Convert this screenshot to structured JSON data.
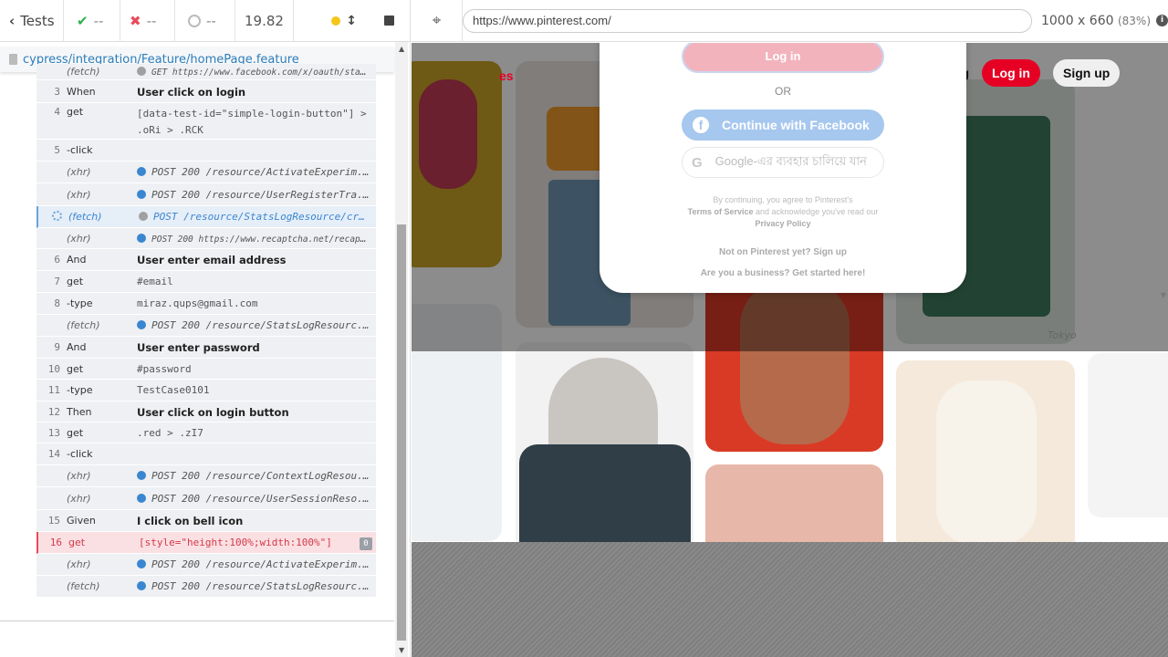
{
  "reporter": {
    "tests_label": "Tests",
    "passed": "--",
    "failed": "--",
    "pending": "--",
    "duration": "19.82",
    "spec_path": "cypress/integration/Feature/homePage.feature"
  },
  "commands": [
    {
      "num": "",
      "name": "(fetch)",
      "msg": "GET https://www.facebook.com/x/oauth/stat...",
      "kind": "evt"
    },
    {
      "num": "3",
      "name": "When",
      "msg": "User click on login",
      "kind": "step"
    },
    {
      "num": "4",
      "name": "get",
      "msg": "[data-test-id=\"simple-login-button\"] > .oRi > .RCK",
      "kind": "cmd"
    },
    {
      "num": "5",
      "name": "-click",
      "msg": "",
      "kind": "cmd"
    },
    {
      "num": "",
      "name": "(xhr)",
      "msg": "POST 200 /resource/ActivateExperim...",
      "kind": "evt"
    },
    {
      "num": "",
      "name": "(xhr)",
      "msg": "POST 200 /resource/UserRegisterTra...",
      "kind": "evt"
    },
    {
      "num": "",
      "name": "(fetch)",
      "msg": "POST /resource/StatsLogResource/cr...",
      "kind": "pending"
    },
    {
      "num": "",
      "name": "(xhr)",
      "msg": "POST 200 https://www.recaptcha.net/recapt...",
      "kind": "evt"
    },
    {
      "num": "6",
      "name": "And",
      "msg": "User enter email address",
      "kind": "step"
    },
    {
      "num": "7",
      "name": "get",
      "msg": "#email",
      "kind": "cmd"
    },
    {
      "num": "8",
      "name": "-type",
      "msg": "miraz.qups@gmail.com",
      "kind": "cmd"
    },
    {
      "num": "",
      "name": "(fetch)",
      "msg": "POST 200 /resource/StatsLogResourc...",
      "kind": "evt"
    },
    {
      "num": "9",
      "name": "And",
      "msg": "User enter password",
      "kind": "step"
    },
    {
      "num": "10",
      "name": "get",
      "msg": "#password",
      "kind": "cmd"
    },
    {
      "num": "11",
      "name": "-type",
      "msg": "TestCase0101",
      "kind": "cmd"
    },
    {
      "num": "12",
      "name": "Then",
      "msg": "User click on login button",
      "kind": "step"
    },
    {
      "num": "13",
      "name": "get",
      "msg": ".red > .zI7",
      "kind": "cmd"
    },
    {
      "num": "14",
      "name": "-click",
      "msg": "",
      "kind": "cmd"
    },
    {
      "num": "",
      "name": "(xhr)",
      "msg": "POST 200 /resource/ContextLogResou...",
      "kind": "evt"
    },
    {
      "num": "",
      "name": "(xhr)",
      "msg": "POST 200 /resource/UserSessionReso...",
      "kind": "evt"
    },
    {
      "num": "15",
      "name": "Given",
      "msg": "I click on bell icon",
      "kind": "step"
    },
    {
      "num": "16",
      "name": "get",
      "msg": "[style=\"height:100%;width:100%\"]",
      "kind": "failed",
      "badge": "0"
    },
    {
      "num": "",
      "name": "(xhr)",
      "msg": "POST 200 /resource/ActivateExperim...",
      "kind": "evt"
    },
    {
      "num": "",
      "name": "(fetch)",
      "msg": "POST 200 /resource/StatsLogResourc...",
      "kind": "evt"
    }
  ],
  "aut": {
    "url": "https://www.pinterest.com/",
    "viewport": "1000 x 660",
    "scale": "(83%)"
  },
  "pinterest": {
    "logo_fragment": "es",
    "nav_blog": "log",
    "nav_login": "Log in",
    "nav_signup": "Sign up",
    "watermark": "Tokyo",
    "modal": {
      "login_button": "Log in",
      "or": "OR",
      "facebook_button": "Continue with Facebook",
      "google_button": "Google-এর ব্যবহার চালিয়ে যান",
      "terms_line1": "By continuing, you agree to Pinterest's",
      "terms_link": "Terms of Service",
      "terms_line2": " and acknowledge you've read our",
      "privacy_link": "Privacy Policy",
      "not_on": "Not on Pinterest yet? Sign up",
      "business": "Are you a business? Get started here!"
    }
  },
  "colors": {
    "accent": "#3a86d0",
    "failed": "#e94a5a",
    "pinterest_red": "#e60023"
  }
}
